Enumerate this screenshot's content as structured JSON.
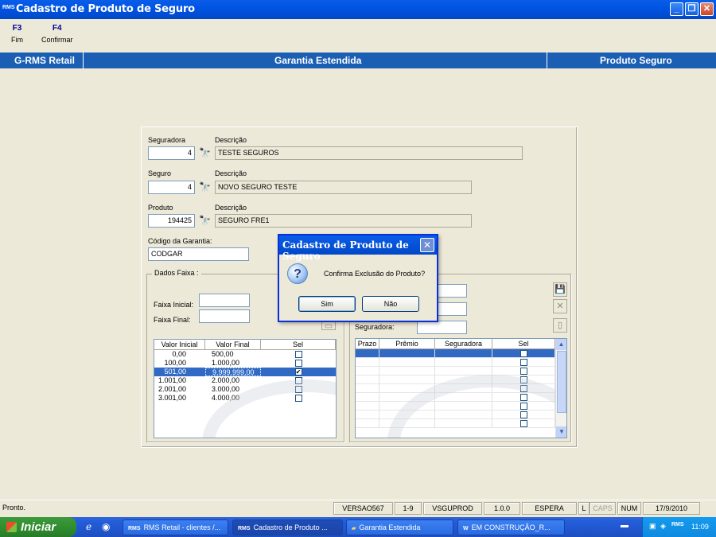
{
  "window": {
    "app_icon": "RMS",
    "title": "Cadastro de Produto de Seguro",
    "buttons": [
      "minimize-icon",
      "restore-icon",
      "close-icon"
    ]
  },
  "function_keys": [
    {
      "key": "F3",
      "label": "Fim"
    },
    {
      "key": "F4",
      "label": "Confirmar"
    }
  ],
  "header_bar": {
    "left": "G-RMS Retail",
    "center": "Garantia Estendida",
    "right": "Produto Seguro"
  },
  "form": {
    "seguradora": {
      "label": "Seguradora",
      "value": "4",
      "desc_label": "Descrição",
      "desc_value": "TESTE SEGUROS"
    },
    "seguro": {
      "label": "Seguro",
      "value": "4",
      "desc_label": "Descrição",
      "desc_value": "NOVO SEGURO TESTE"
    },
    "produto": {
      "label": "Produto",
      "value": "194425",
      "desc_label": "Descrição",
      "desc_value": "SEGURO FRE1"
    },
    "codigo_garantia": {
      "label": "Código da Garantia:",
      "value": "CODGAR"
    }
  },
  "dados_faixa": {
    "title": "Dados Faixa :",
    "faixa_inicial_label": "Faixa Inicial:",
    "faixa_final_label": "Faixa Final:",
    "faixa_inicial_value": "",
    "faixa_final_value": "",
    "columns": [
      "Valor Inicial",
      "Valor Final",
      "Sel"
    ],
    "rows": [
      {
        "inicial": "0,00",
        "final": "500,00",
        "sel": false,
        "selected": false
      },
      {
        "inicial": "100,00",
        "final": "1.000,00",
        "sel": false,
        "selected": false
      },
      {
        "inicial": "501,00",
        "final": "9.999.999,00",
        "sel": true,
        "selected": true
      },
      {
        "inicial": "1.001,00",
        "final": "2.000,00",
        "sel": false,
        "selected": false
      },
      {
        "inicial": "2.001,00",
        "final": "3.000,00",
        "sel": false,
        "selected": false
      },
      {
        "inicial": "3.001,00",
        "final": "4.000,00",
        "sel": false,
        "selected": false
      }
    ]
  },
  "premio": {
    "seguradora_label": "Seguradora:",
    "columns": [
      "Prazo",
      "Prêmio",
      "Seguradora",
      "Sel"
    ],
    "row_count": 9
  },
  "dialog": {
    "title": "Cadastro de Produto de Seguro",
    "icon": "question-icon",
    "message": "Confirma Exclusão do Produto?",
    "yes": "Sim",
    "no": "Não"
  },
  "statusbar": {
    "message": "Pronto.",
    "panels": [
      "VERSAO567",
      "1-9",
      "VSGUPROD",
      "1.0.0",
      "ESPERA",
      "L",
      "CAPS",
      "NUM",
      "17/9/2010"
    ]
  },
  "taskbar": {
    "start": "Iniciar",
    "tasks": [
      "RMS Retail - clientes /...",
      "Cadastro de Produto ...",
      "Garantia Estendida",
      "EM CONSTRUÇÃO_R..."
    ],
    "clock": "11:09"
  }
}
